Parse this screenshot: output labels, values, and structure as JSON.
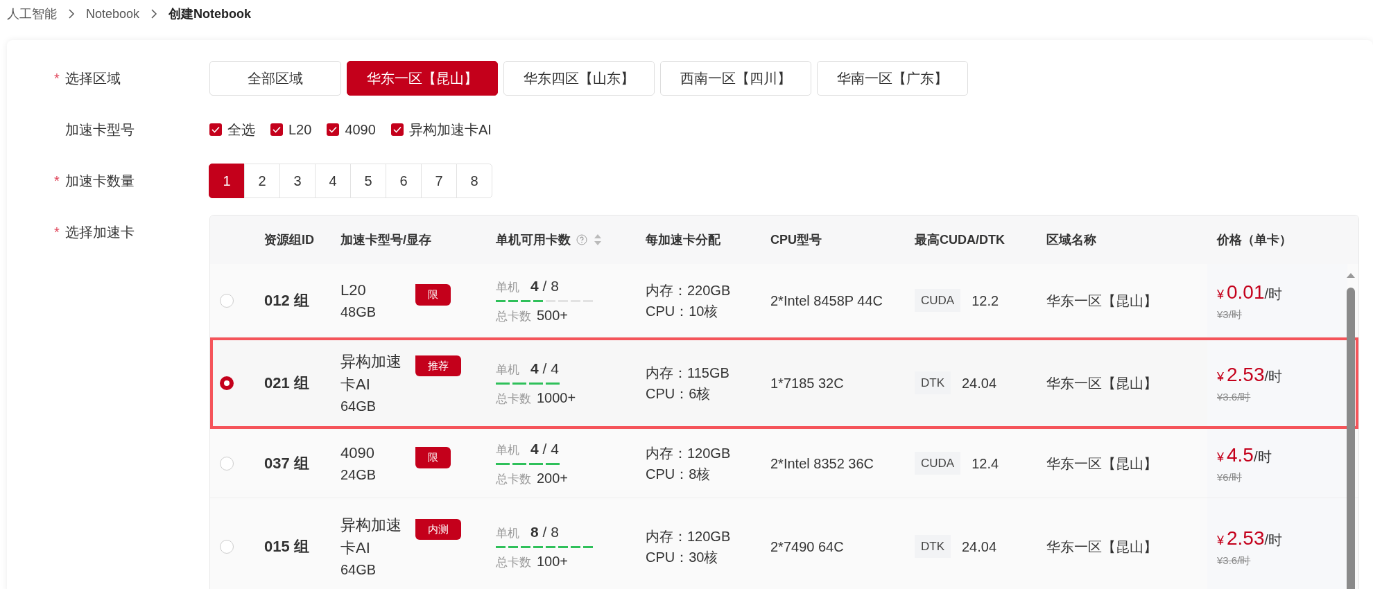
{
  "breadcrumb": [
    {
      "label": "人工智能",
      "current": false
    },
    {
      "label": "Notebook",
      "current": false
    },
    {
      "label": "创建Notebook",
      "current": true
    }
  ],
  "region": {
    "required_mark": "*",
    "label": "选择区域",
    "options": [
      {
        "label": "全部区域",
        "selected": false
      },
      {
        "label": "华东一区【昆山】",
        "selected": true
      },
      {
        "label": "华东四区【山东】",
        "selected": false
      },
      {
        "label": "西南一区【四川】",
        "selected": false
      },
      {
        "label": "华南一区【广东】",
        "selected": false
      }
    ]
  },
  "card_type": {
    "label": "加速卡型号",
    "options": [
      {
        "label": "全选",
        "checked": true
      },
      {
        "label": "L20",
        "checked": true
      },
      {
        "label": "4090",
        "checked": true
      },
      {
        "label": "异构加速卡AI",
        "checked": true
      }
    ]
  },
  "card_count": {
    "required_mark": "*",
    "label": "加速卡数量",
    "options": [
      {
        "label": "1",
        "selected": true
      },
      {
        "label": "2",
        "selected": false
      },
      {
        "label": "3",
        "selected": false
      },
      {
        "label": "4",
        "selected": false
      },
      {
        "label": "5",
        "selected": false
      },
      {
        "label": "6",
        "selected": false
      },
      {
        "label": "7",
        "selected": false
      },
      {
        "label": "8",
        "selected": false
      }
    ]
  },
  "card_select": {
    "required_mark": "*",
    "label": "选择加速卡",
    "table": {
      "columns": [
        {
          "label": "资源组ID"
        },
        {
          "label": "加速卡型号/显存"
        },
        {
          "label": "单机可用卡数",
          "help": true,
          "sortable": true
        },
        {
          "label": "每加速卡分配"
        },
        {
          "label": "CPU型号"
        },
        {
          "label": "最高CUDA/DTK"
        },
        {
          "label": "区域名称"
        },
        {
          "label": "价格（单卡）"
        }
      ],
      "rows": [
        {
          "selected": false,
          "group": "012 组",
          "model": "L20",
          "tag": "限",
          "memory": "48GB",
          "node_label": "单机",
          "available": "4",
          "capacity": "/ 8",
          "segments": [
            {
              "filled": true
            },
            {
              "filled": true
            },
            {
              "filled": true
            },
            {
              "filled": true
            },
            {
              "filled": false
            },
            {
              "filled": false
            },
            {
              "filled": false
            },
            {
              "filled": false
            }
          ],
          "total_label": "总卡数",
          "total": "500+",
          "ram": "内存：220GB",
          "cpu": "CPU：10核",
          "cpu_model": "2*Intel 8458P 44C",
          "sdk_kind": "CUDA",
          "sdk_version": "12.2",
          "region": "华东一区【昆山】",
          "currency": "¥",
          "price": "0.01",
          "unit": "/时",
          "old_price": "¥3/时"
        },
        {
          "selected": true,
          "group": "021 组",
          "model": "异构加速卡AI",
          "tag": "推荐",
          "memory": "64GB",
          "node_label": "单机",
          "available": "4",
          "capacity": "/ 4",
          "segments": [
            {
              "filled": true
            },
            {
              "filled": true
            },
            {
              "filled": true
            },
            {
              "filled": true
            }
          ],
          "total_label": "总卡数",
          "total": "1000+",
          "ram": "内存：115GB",
          "cpu": "CPU：6核",
          "cpu_model": "1*7185 32C",
          "sdk_kind": "DTK",
          "sdk_version": "24.04",
          "region": "华东一区【昆山】",
          "currency": "¥",
          "price": "2.53",
          "unit": "/时",
          "old_price": "¥3.6/时"
        },
        {
          "selected": false,
          "group": "037 组",
          "model": "4090",
          "tag": "限",
          "memory": "24GB",
          "node_label": "单机",
          "available": "4",
          "capacity": "/ 4",
          "segments": [
            {
              "filled": true
            },
            {
              "filled": true
            },
            {
              "filled": true
            },
            {
              "filled": true
            }
          ],
          "total_label": "总卡数",
          "total": "200+",
          "ram": "内存：120GB",
          "cpu": "CPU：8核",
          "cpu_model": "2*Intel 8352 36C",
          "sdk_kind": "CUDA",
          "sdk_version": "12.4",
          "region": "华东一区【昆山】",
          "currency": "¥",
          "price": "4.5",
          "unit": "/时",
          "old_price": "¥6/时"
        },
        {
          "selected": false,
          "group": "015 组",
          "model": "异构加速卡AI",
          "tag": "内测",
          "memory": "64GB",
          "node_label": "单机",
          "available": "8",
          "capacity": "/ 8",
          "segments": [
            {
              "filled": true
            },
            {
              "filled": true
            },
            {
              "filled": true
            },
            {
              "filled": true
            },
            {
              "filled": true
            },
            {
              "filled": true
            },
            {
              "filled": true
            },
            {
              "filled": true
            }
          ],
          "total_label": "总卡数",
          "total": "100+",
          "ram": "内存：120GB",
          "cpu": "CPU：30核",
          "cpu_model": "2*7490 64C",
          "sdk_kind": "DTK",
          "sdk_version": "24.04",
          "region": "华东一区【昆山】",
          "currency": "¥",
          "price": "2.53",
          "unit": "/时",
          "old_price": "¥3.6/时"
        }
      ]
    }
  }
}
